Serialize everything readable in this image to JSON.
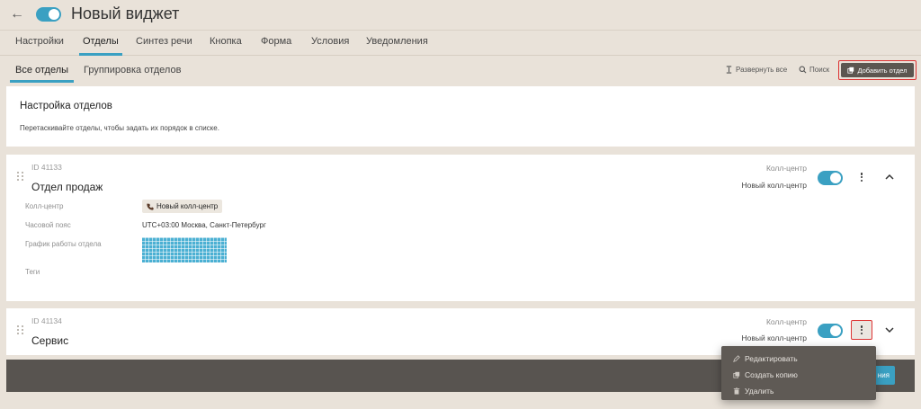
{
  "header": {
    "title": "Новый виджет",
    "back_icon": "arrow-left-icon",
    "widget_enabled": true,
    "accent_color": "#3aa0c2"
  },
  "tabs": [
    {
      "label": "Настройки",
      "active": false
    },
    {
      "label": "Отделы",
      "active": true
    },
    {
      "label": "Синтез речи",
      "active": false
    },
    {
      "label": "Кнопка",
      "active": false
    },
    {
      "label": "Форма",
      "active": false
    },
    {
      "label": "Условия",
      "active": false
    },
    {
      "label": "Уведомления",
      "active": false
    }
  ],
  "subtabs": [
    {
      "label": "Все отделы",
      "active": true
    },
    {
      "label": "Группировка отделов",
      "active": false
    }
  ],
  "toolbar": {
    "expand_all": "Развернуть все",
    "search": "Поиск",
    "add_department": "Добавить отдел"
  },
  "info": {
    "title": "Настройка отделов",
    "description": "Перетаскивайте отделы, чтобы задать их порядок в списке."
  },
  "departments": [
    {
      "id": "ID 41133",
      "name": "Отдел продаж",
      "meta_label": "Колл-центр",
      "meta_value": "Новый колл-центр",
      "enabled": true,
      "expanded": true,
      "fields": {
        "call_center_label": "Колл-центр",
        "call_center_value": "Новый колл-центр",
        "timezone_label": "Часовой пояс",
        "timezone_value": "UTC+03:00 Москва, Санкт-Петербург",
        "schedule_label": "График работы отдела",
        "tags_label": "Теги"
      }
    },
    {
      "id": "ID 41134",
      "name": "Сервис",
      "meta_label": "Колл-центр",
      "meta_value": "Новый колл-центр",
      "enabled": true,
      "expanded": false
    }
  ],
  "context_menu": {
    "items": [
      {
        "label": "Редактировать",
        "icon": "pencil-icon"
      },
      {
        "label": "Создать копию",
        "icon": "copy-icon"
      },
      {
        "label": "Удалить",
        "icon": "trash-icon"
      }
    ]
  },
  "footer": {
    "save_label": "ния"
  }
}
